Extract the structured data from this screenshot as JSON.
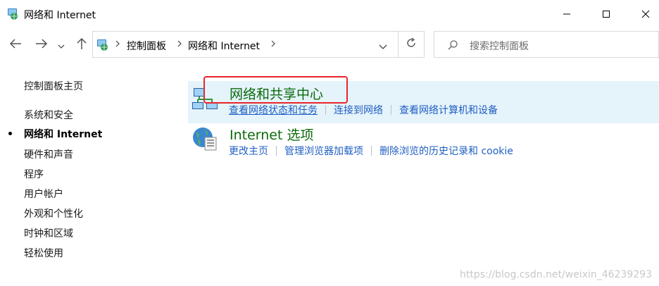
{
  "window": {
    "title": "网络和 Internet",
    "icons": {
      "app": "network-globe-icon",
      "minimize": "minimize-icon",
      "maximize": "maximize-icon",
      "close": "close-icon"
    }
  },
  "nav": {
    "icons": {
      "back": "arrow-left-icon",
      "forward": "arrow-right-icon",
      "recent": "chevron-down-icon",
      "up": "arrow-up-icon",
      "refresh": "refresh-icon"
    },
    "breadcrumb": [
      "控制面板",
      "网络和 Internet"
    ],
    "search_placeholder": "搜索控制面板"
  },
  "sidebar": {
    "home": "控制面板主页",
    "items": [
      {
        "label": "系统和安全",
        "active": false
      },
      {
        "label": "网络和 Internet",
        "active": true
      },
      {
        "label": "硬件和声音",
        "active": false
      },
      {
        "label": "程序",
        "active": false
      },
      {
        "label": "用户帐户",
        "active": false
      },
      {
        "label": "外观和个性化",
        "active": false
      },
      {
        "label": "时钟和区域",
        "active": false
      },
      {
        "label": "轻松使用",
        "active": false
      }
    ]
  },
  "main": {
    "categories": [
      {
        "title": "网络和共享中心",
        "icon": "network-sharing-icon",
        "links": [
          "查看网络状态和任务",
          "连接到网络",
          "查看网络计算机和设备"
        ]
      },
      {
        "title": "Internet 选项",
        "icon": "internet-options-globe-icon",
        "links": [
          "更改主页",
          "管理浏览器加载项",
          "删除浏览的历史记录和 cookie"
        ]
      }
    ]
  },
  "watermark": "https://blog.csdn.net/weixin_46239293",
  "colors": {
    "accent_link": "#1f5fc2",
    "category_title": "#0b6a0b",
    "highlight_bg": "#e5f3fb",
    "annotation_red": "#e8262c"
  }
}
